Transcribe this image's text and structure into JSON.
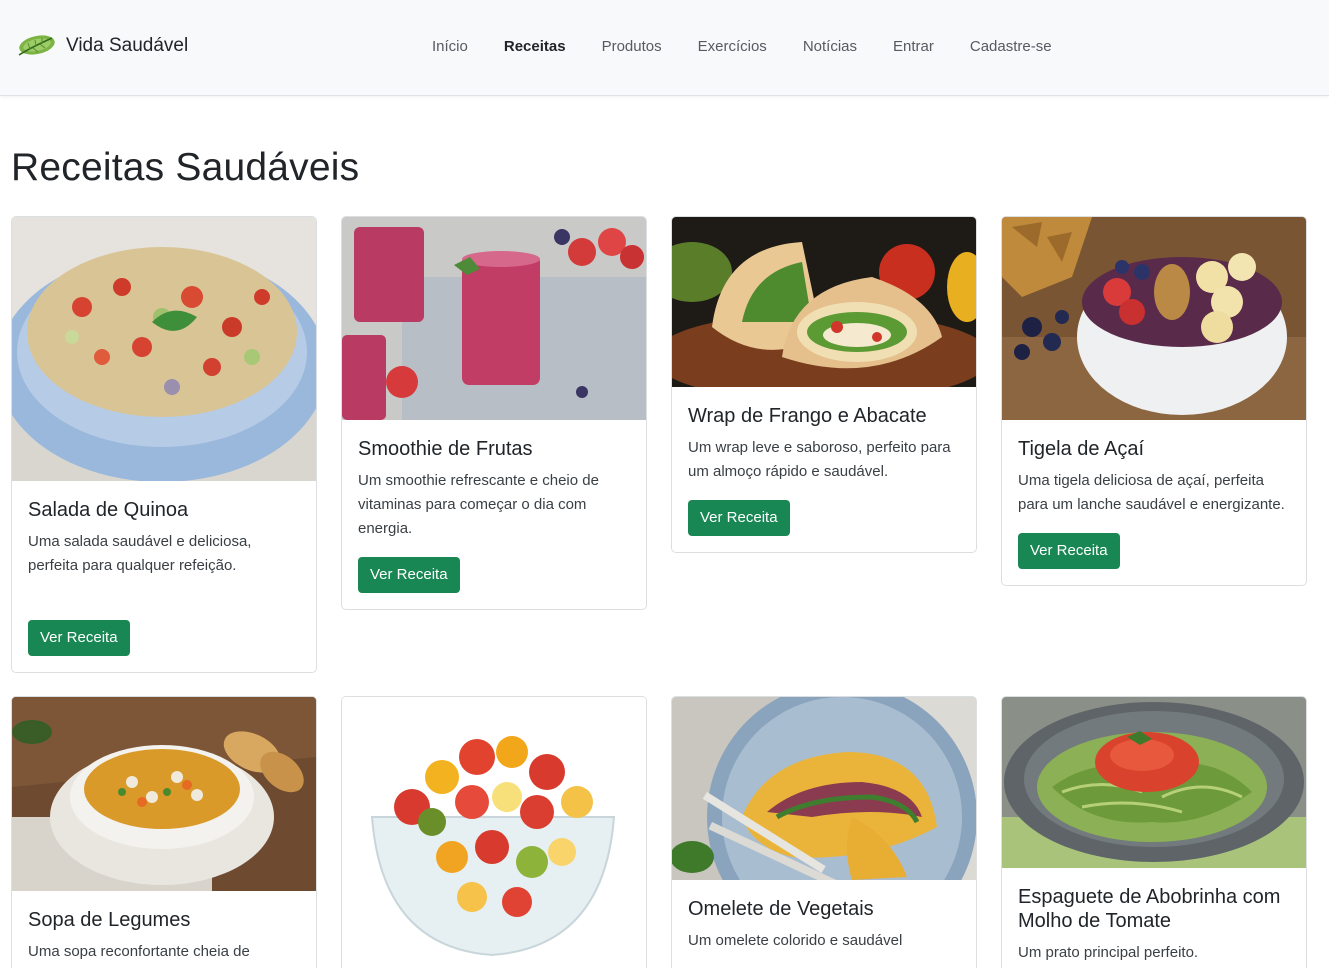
{
  "brand": {
    "name": "Vida Saudável",
    "logo_icon": "leaf-icon"
  },
  "nav": {
    "items": [
      {
        "label": "Início",
        "active": false
      },
      {
        "label": "Receitas",
        "active": true
      },
      {
        "label": "Produtos",
        "active": false
      },
      {
        "label": "Exercícios",
        "active": false
      },
      {
        "label": "Notícias",
        "active": false
      },
      {
        "label": "Entrar",
        "active": false
      },
      {
        "label": "Cadastre-se",
        "active": false
      }
    ]
  },
  "page": {
    "title": "Receitas Saudáveis"
  },
  "recipes": [
    {
      "title": "Salada de Quinoa",
      "description": "Uma salada saudável e deliciosa, perfeita para qualquer refeição.",
      "button": "Ver Receita",
      "image": "quinoa-salad-photo"
    },
    {
      "title": "Smoothie de Frutas",
      "description": "Um smoothie refrescante e cheio de vitaminas para começar o dia com energia.",
      "button": "Ver Receita",
      "image": "berry-smoothie-photo"
    },
    {
      "title": "Wrap de Frango e Abacate",
      "description": "Um wrap leve e saboroso, perfeito para um almoço rápido e saudável.",
      "button": "Ver Receita",
      "image": "chicken-wrap-photo"
    },
    {
      "title": "Tigela de Açaí",
      "description": "Uma tigela deliciosa de açaí, perfeita para um lanche saudável e energizante.",
      "button": "Ver Receita",
      "image": "acai-bowl-photo"
    },
    {
      "title": "Sopa de Legumes",
      "description": "Uma sopa reconfortante cheia de",
      "image": "vegetable-soup-photo"
    },
    {
      "title": "",
      "description": "",
      "image": "fruit-salad-photo"
    },
    {
      "title": "Omelete de Vegetais",
      "description": "Um omelete colorido e saudável",
      "image": "vegetable-omelet-photo"
    },
    {
      "title": "Espaguete de Abobrinha com Molho de Tomate",
      "description": "Um prato principal perfeito.",
      "image": "zucchini-spaghetti-photo"
    }
  ],
  "colors": {
    "primary_button": "#198754",
    "navbar_bg": "#f8f9fa"
  }
}
